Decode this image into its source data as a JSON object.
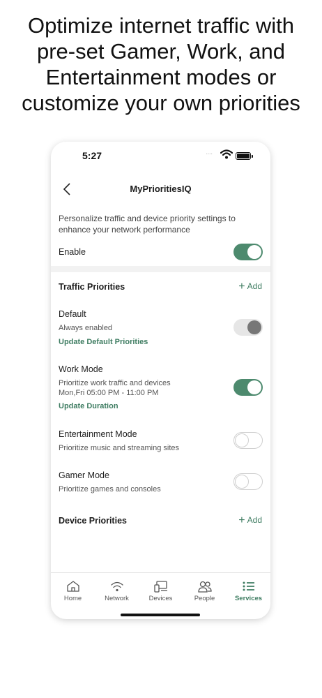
{
  "headline": {
    "line1": "Optimize internet traffic with",
    "line2": "pre-set Gamer, Work, and",
    "line3": "Entertainment modes or",
    "line4": "customize your own priorities"
  },
  "status_bar": {
    "time": "5:27",
    "dots": "····"
  },
  "header": {
    "title": "MyPrioritiesIQ"
  },
  "intro": {
    "description": "Personalize traffic and device priority settings to enhance your network performance",
    "enable_label": "Enable",
    "enabled": true
  },
  "traffic_priorities": {
    "title": "Traffic Priorities",
    "add_label": "Add",
    "items": [
      {
        "title": "Default",
        "subtitle": "Always enabled",
        "link": "Update Default Priorities",
        "state": "locked-on"
      },
      {
        "title": "Work Mode",
        "subtitle": "Prioritize work traffic and devices",
        "schedule": "Mon,Fri 05:00 PM - 11:00 PM",
        "link": "Update Duration",
        "state": "on"
      },
      {
        "title": "Entertainment Mode",
        "subtitle": "Prioritize music and streaming sites",
        "state": "off"
      },
      {
        "title": "Gamer Mode",
        "subtitle": "Prioritize games and consoles",
        "state": "off"
      }
    ]
  },
  "device_priorities": {
    "title": "Device Priorities",
    "add_label": "Add"
  },
  "tabbar": {
    "tabs": [
      {
        "label": "Home",
        "icon": "home-icon"
      },
      {
        "label": "Network",
        "icon": "wifi-icon"
      },
      {
        "label": "Devices",
        "icon": "devices-icon"
      },
      {
        "label": "People",
        "icon": "people-icon"
      },
      {
        "label": "Services",
        "icon": "list-icon",
        "active": true
      }
    ]
  },
  "colors": {
    "accent": "#3f7d62",
    "toggle_on": "#4d8a6e"
  }
}
